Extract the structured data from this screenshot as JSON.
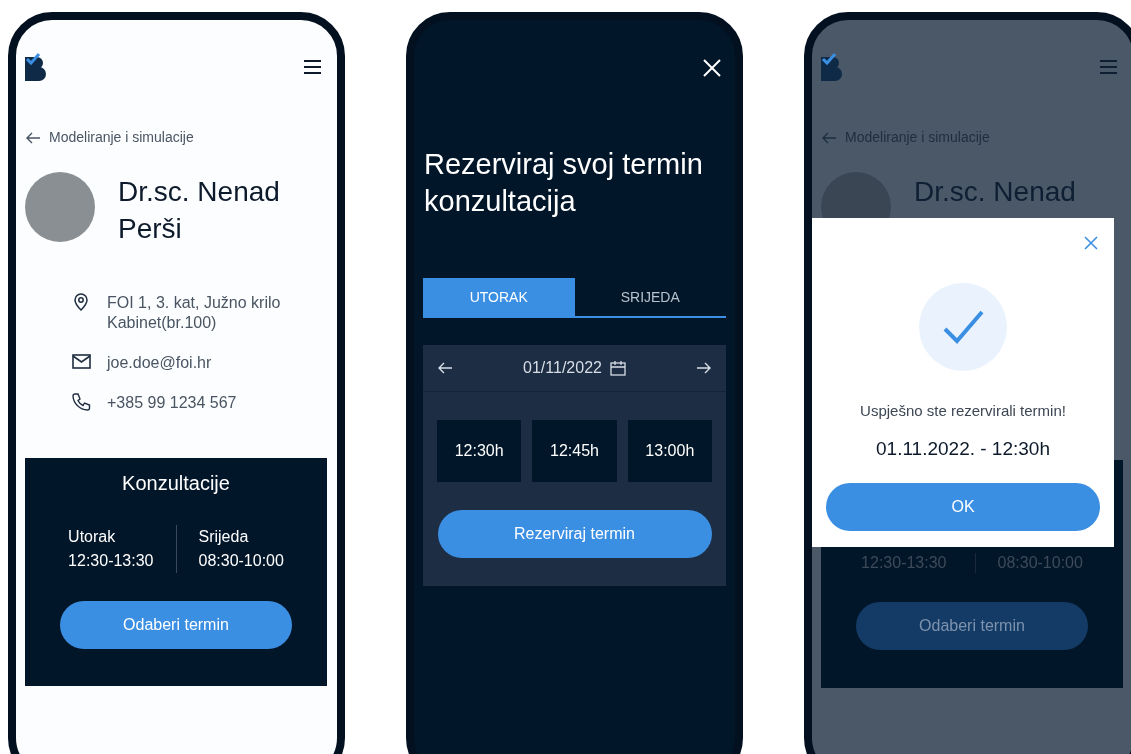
{
  "screens": [
    {
      "kind": "profile",
      "back_link": "Modeliranje i simulacije",
      "name": "Dr.sc. Nenad Perši",
      "contacts": [
        {
          "kind": "location",
          "lines": [
            "FOI 1, 3. kat, Južno krilo",
            "Kabinet(br.100)"
          ]
        },
        {
          "kind": "email",
          "lines": [
            "joe.doe@foi.hr"
          ]
        },
        {
          "kind": "phone",
          "lines": [
            "+385 99 1234 567"
          ]
        }
      ],
      "consultation": {
        "title": "Konzultacije",
        "slots": [
          {
            "day": "Utorak",
            "time": "12:30-13:30"
          },
          {
            "day": "Srijeda",
            "time": "08:30-10:00"
          }
        ],
        "button": "Odaberi termin"
      }
    },
    {
      "kind": "booking",
      "title": "Rezerviraj svoj termin konzultacija",
      "tabs": [
        {
          "label": "UTORAK",
          "selected": true
        },
        {
          "label": "SRIJEDA",
          "selected": false
        }
      ],
      "date": "01/11/2022",
      "times": [
        "12:30h",
        "12:45h",
        "13:00h"
      ],
      "button": "Rezerviraj termin"
    },
    {
      "kind": "confirmation",
      "back_link": "Modeliranje i simulacije",
      "name": "Dr.sc. Nenad",
      "consultation": {
        "slots": [
          {
            "time": "12:30-13:30"
          },
          {
            "time": "08:30-10:00"
          }
        ],
        "button": "Odaberi termin"
      },
      "dialog": {
        "message": "Uspješno ste rezervirali termin!",
        "booking": "01.11.2022. - 12:30h",
        "button": "OK"
      }
    }
  ]
}
